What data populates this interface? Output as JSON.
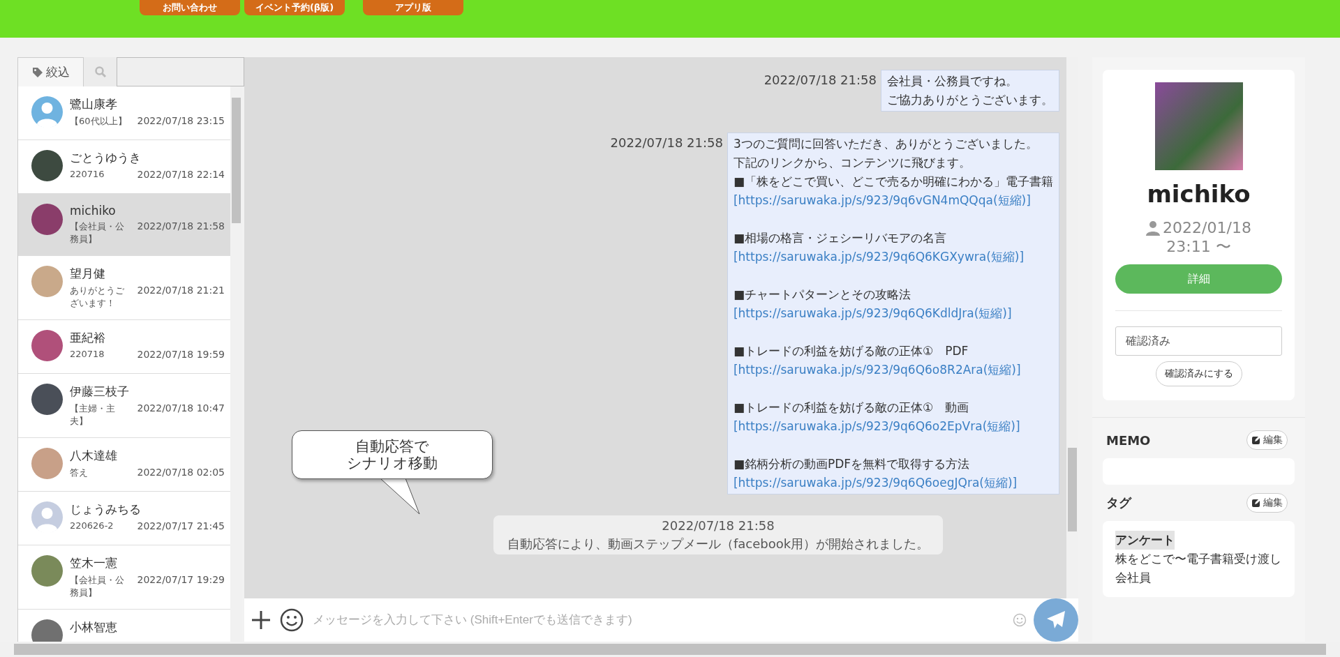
{
  "top_buttons": [
    {
      "label": "お問い合わせ"
    },
    {
      "label": "イベント予約(β版)"
    },
    {
      "label": "アプリ版"
    }
  ],
  "filter": {
    "tab_label": "絞込"
  },
  "contacts": [
    {
      "name": "鷺山康孝",
      "preview": "【60代以上】",
      "time": "2022/07/18 23:15",
      "kind": "default",
      "color": "#6fb3e0",
      "selected": false
    },
    {
      "name": "ごとうゆうき",
      "preview": "220716",
      "time": "2022/07/18 22:14",
      "kind": "photo",
      "color": "#3d4a40",
      "selected": false
    },
    {
      "name": "michiko",
      "preview": "【会社員・公務員】",
      "time": "2022/07/18 21:58",
      "kind": "photo",
      "color": "#8a3d6a",
      "selected": true
    },
    {
      "name": "望月健",
      "preview": "ありがとうございます！",
      "time": "2022/07/18 21:21",
      "kind": "photo",
      "color": "#c9a98a",
      "selected": false
    },
    {
      "name": "亜紀裕",
      "preview": "220718",
      "time": "2022/07/18 19:59",
      "kind": "photo",
      "color": "#b0507a",
      "selected": false
    },
    {
      "name": "伊藤三枝子",
      "preview": "【主婦・主夫】",
      "time": "2022/07/18 10:47",
      "kind": "photo",
      "color": "#4a4f58",
      "selected": false
    },
    {
      "name": "八木達雄",
      "preview": "答え",
      "time": "2022/07/18 02:05",
      "kind": "photo",
      "color": "#c8a088",
      "selected": false
    },
    {
      "name": "じょうみちる",
      "preview": "220626-2",
      "time": "2022/07/17 21:45",
      "kind": "default",
      "color": "#c5cde0",
      "selected": false
    },
    {
      "name": "笠木一憲",
      "preview": "【会社員・公務員】",
      "time": "2022/07/17 19:29",
      "kind": "photo",
      "color": "#7a8a5a",
      "selected": false
    },
    {
      "name": "小林智恵",
      "kind": "photo",
      "color": "#707070",
      "selected": false
    }
  ],
  "messages": [
    {
      "kind": "outgoing",
      "time": "2022/07/18 21:58",
      "lines": [
        {
          "kind": "text",
          "text": "会社員・公務員ですね。"
        },
        {
          "kind": "text",
          "text": "ご協力ありがとうございます。"
        }
      ]
    },
    {
      "kind": "outgoing",
      "time": "2022/07/18 21:58",
      "lines": [
        {
          "kind": "text",
          "text": "3つのご質問に回答いただき、ありがとうございました。"
        },
        {
          "kind": "text",
          "text": "下記のリンクから、コンテンツに飛びます。"
        },
        {
          "kind": "text",
          "text": "■「株をどこで買い、どこで売るか明確にわかる」電子書籍"
        },
        {
          "kind": "link",
          "text": "[https://saruwaka.jp/s/923/9q6vGN4mQQqa(短縮)]"
        },
        {
          "kind": "blank"
        },
        {
          "kind": "text",
          "text": "■相場の格言・ジェシーリバモアの名言"
        },
        {
          "kind": "link",
          "text": "[https://saruwaka.jp/s/923/9q6Q6KGXywra(短縮)]"
        },
        {
          "kind": "blank"
        },
        {
          "kind": "text",
          "text": "■チャートパターンとその攻略法"
        },
        {
          "kind": "link",
          "text": "[https://saruwaka.jp/s/923/9q6Q6KdldJra(短縮)]"
        },
        {
          "kind": "blank"
        },
        {
          "kind": "text",
          "text": "■トレードの利益を妨げる敵の正体①　PDF"
        },
        {
          "kind": "link",
          "text": "[https://saruwaka.jp/s/923/9q6Q6o8R2Ara(短縮)]"
        },
        {
          "kind": "blank"
        },
        {
          "kind": "text",
          "text": "■トレードの利益を妨げる敵の正体①　動画"
        },
        {
          "kind": "link",
          "text": "[https://saruwaka.jp/s/923/9q6Q6o2EpVra(短縮)]"
        },
        {
          "kind": "blank"
        },
        {
          "kind": "text",
          "text": "■銘柄分析の動画PDFを無料で取得する方法"
        },
        {
          "kind": "link",
          "text": "[https://saruwaka.jp/s/923/9q6Q6oegJQra(短縮)]"
        }
      ]
    },
    {
      "kind": "system",
      "time": "2022/07/18 21:58",
      "text": "自動応答により、動画ステップメール（facebook用）が開始されました。"
    }
  ],
  "annotation": {
    "lines": [
      "自動応答で",
      "シナリオ移動"
    ]
  },
  "composer": {
    "placeholder": "メッセージを入力して下さい (Shift+Enterでも送信できます)"
  },
  "profile": {
    "name": "michiko",
    "since_date": "2022/01/18",
    "since_time": "23:11 〜",
    "detail_button": "詳細",
    "status_value": "確認済み",
    "confirm_button": "確認済みにする"
  },
  "memo": {
    "title": "MEMO",
    "edit": "編集"
  },
  "tags": {
    "title": "タグ",
    "edit": "編集",
    "items": [
      {
        "kind": "heading",
        "text": "アンケート"
      },
      {
        "kind": "tag",
        "text": "株をどこで〜電子書籍受け渡し"
      },
      {
        "kind": "tag",
        "text": "会社員"
      }
    ]
  }
}
